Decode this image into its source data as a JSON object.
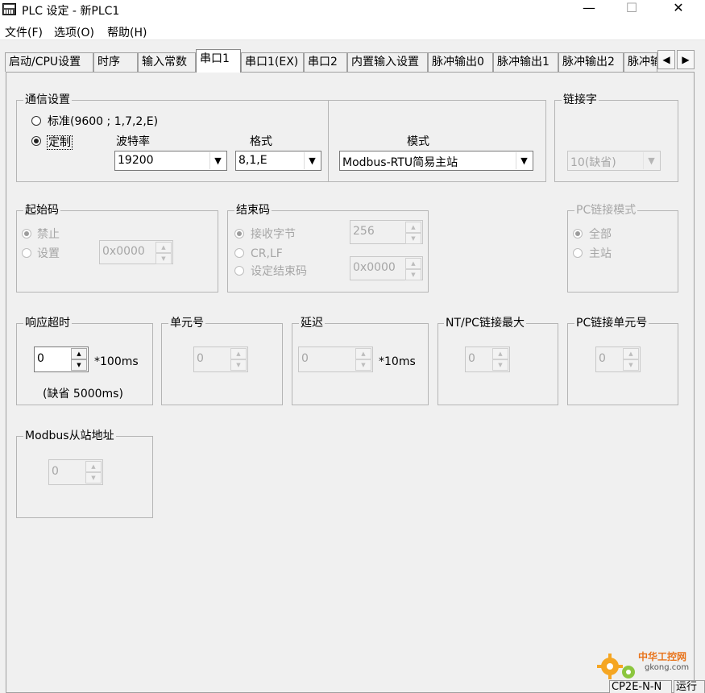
{
  "window": {
    "title": "PLC 设定 - 新PLC1",
    "minimize": "—",
    "maximize": "☐",
    "close": "✕"
  },
  "menu": [
    "文件(F)",
    "选项(O)",
    "帮助(H)"
  ],
  "tabs": [
    {
      "label": "启动/CPU设置"
    },
    {
      "label": "时序"
    },
    {
      "label": "输入常数"
    },
    {
      "label": "串口1"
    },
    {
      "label": "串口1(EX)"
    },
    {
      "label": "串口2"
    },
    {
      "label": "内置输入设置"
    },
    {
      "label": "脉冲输出0"
    },
    {
      "label": "脉冲输出1"
    },
    {
      "label": "脉冲输出2"
    },
    {
      "label": "脉冲输"
    }
  ],
  "tab_scroll": {
    "left": "◀",
    "right": "▶"
  },
  "comm": {
    "title": "通信设置",
    "standard_label": "标准(9600 ; 1,7,2,E)",
    "custom_label": "定制",
    "baud_label": "波特率",
    "baud_value": "19200",
    "format_label": "格式",
    "format_value": "8,1,E",
    "mode_label": "模式",
    "mode_value": "Modbus-RTU简易主站",
    "selected": "custom"
  },
  "link_word": {
    "title": "链接字",
    "value": "10(缺省)"
  },
  "start_code": {
    "title": "起始码",
    "disable_label": "禁止",
    "set_label": "设置",
    "value": "0x0000"
  },
  "end_code": {
    "title": "结束码",
    "receive_bytes_label": "接收字节",
    "crlf_label": "CR,LF",
    "set_end_label": "设定结束码",
    "bytes_value": "256",
    "code_value": "0x0000"
  },
  "pc_link_mode": {
    "title": "PC链接模式",
    "all_label": "全部",
    "master_label": "主站"
  },
  "response_timeout": {
    "title": "响应超时",
    "value": "0",
    "unit": "*100ms",
    "note": "(缺省 5000ms)"
  },
  "unit_no": {
    "title": "单元号",
    "value": "0"
  },
  "delay": {
    "title": "延迟",
    "value": "0",
    "unit": "*10ms"
  },
  "nt_pc_link_max": {
    "title": "NT/PC链接最大",
    "value": "0"
  },
  "pc_link_unit_no": {
    "title": "PC链接单元号",
    "value": "0"
  },
  "modbus_slave": {
    "title": "Modbus从站地址",
    "value": "0"
  },
  "status": {
    "model": "CP2E-N-N",
    "state": "运行"
  },
  "watermark": {
    "site": "中华工控网",
    "url": "gkong.com"
  },
  "icons": {
    "dropdown": "▼",
    "spin_up": "▲",
    "spin_down": "▼"
  }
}
